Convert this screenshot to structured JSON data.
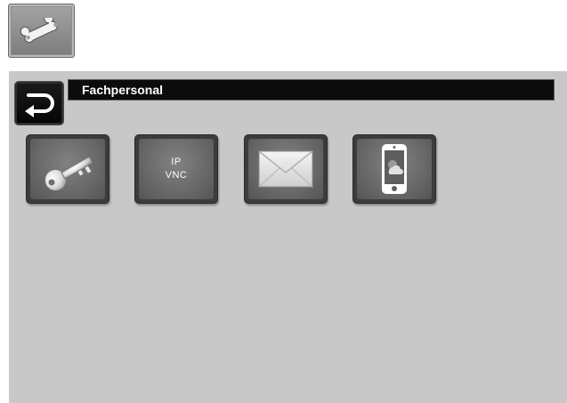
{
  "toolbar": {
    "tool_icon": "wrench-icon"
  },
  "header": {
    "back_icon": "back-arrow-icon",
    "title": "Fachpersonal"
  },
  "tiles": [
    {
      "name": "key",
      "icon": "key-icon"
    },
    {
      "name": "ip-vnc",
      "icon": "text",
      "line1": "IP",
      "line2": "VNC"
    },
    {
      "name": "mail",
      "icon": "envelope-icon"
    },
    {
      "name": "app",
      "icon": "smartphone-cloud-icon"
    }
  ],
  "colors": {
    "panel_bg": "#c8c8c8",
    "header_bg": "#0c0c0c",
    "header_text": "#ffffff",
    "tile_bg": "#6a6a6a"
  }
}
